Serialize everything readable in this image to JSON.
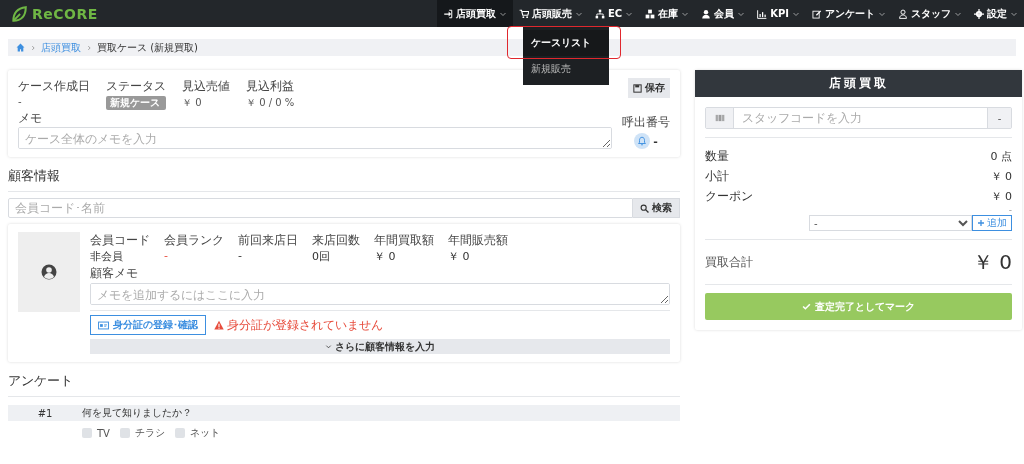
{
  "brand": "ReCORE",
  "nav": [
    {
      "label": "店頭買取",
      "selected": true
    },
    {
      "label": "店頭販売",
      "selected": false,
      "menu": [
        {
          "label": "ケースリスト",
          "highlighted": true
        },
        {
          "label": "新規販売",
          "highlighted": false
        }
      ]
    },
    {
      "label": "EC",
      "selected": false
    },
    {
      "label": "在庫",
      "selected": false
    },
    {
      "label": "会員",
      "selected": false
    },
    {
      "label": "KPI",
      "selected": false
    },
    {
      "label": "アンケート",
      "selected": false
    },
    {
      "label": "スタッフ",
      "selected": false
    },
    {
      "label": "設定",
      "selected": false
    }
  ],
  "breadcrumb": [
    "店頭買取",
    "買取ケース (新規買取)"
  ],
  "case": {
    "fields": [
      {
        "label": "ケース作成日",
        "value": "-",
        "kind": "text"
      },
      {
        "label": "ステータス",
        "value": "新規ケース",
        "kind": "badge"
      },
      {
        "label": "見込売値",
        "value": "￥ 0",
        "kind": "text"
      },
      {
        "label": "見込利益",
        "value": "￥ 0 / 0 %",
        "kind": "text"
      }
    ],
    "save": "保存",
    "memo_label": "メモ",
    "memo_placeholder": "ケース全体のメモを入力",
    "call_label": "呼出番号",
    "call_value": "-"
  },
  "customer": {
    "heading": "顧客情報",
    "search_placeholder": "会員コード･名前",
    "search_button": "検索",
    "fields": [
      {
        "label": "会員コード",
        "value": "非会員",
        "kind": "plain"
      },
      {
        "label": "会員ランク",
        "value": "-",
        "kind": "alert"
      },
      {
        "label": "前回来店日",
        "value": "-",
        "kind": "plain"
      },
      {
        "label": "来店回数",
        "value": "0回",
        "kind": "plain"
      },
      {
        "label": "年間買取額",
        "value": "￥ 0",
        "kind": "plain"
      },
      {
        "label": "年間販売額",
        "value": "￥ 0",
        "kind": "plain"
      }
    ],
    "memo_label": "顧客メモ",
    "memo_placeholder": "メモを追加するにはここに入力",
    "id_button": "身分証の登録･確認",
    "warning": "身分証が登録されていません",
    "more": "さらに顧客情報を入力"
  },
  "survey": {
    "heading": "アンケート",
    "questions": [
      {
        "number": "#1",
        "text": "何を見て知りましたか？",
        "options": [
          {
            "label": "TV",
            "checked": false
          },
          {
            "label": "チラシ",
            "checked": false
          },
          {
            "label": "ネット",
            "checked": false
          }
        ]
      }
    ]
  },
  "summary": {
    "title": "店頭買取",
    "staff_placeholder": "スタッフコードを入力",
    "staff_button": "-",
    "rows": [
      {
        "label": "数量",
        "value": "0 点"
      },
      {
        "label": "小計",
        "value": "￥ 0"
      },
      {
        "label": "クーポン",
        "value": "￥ 0"
      }
    ],
    "coupon_note": "-",
    "coupon_select": "-",
    "add": "追加",
    "total_label": "買取合計",
    "total": "￥ 0",
    "mark_button": "査定完了としてマーク"
  }
}
